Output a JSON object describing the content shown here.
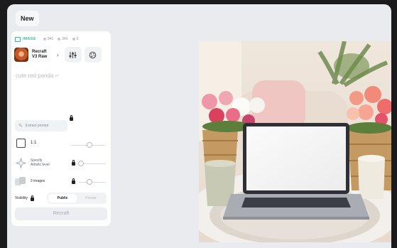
{
  "tab": {
    "label": "New"
  },
  "panel": {
    "meta": {
      "type_label": "IMAGE",
      "count_a": "341",
      "count_b": "341",
      "count_c": "0"
    },
    "model": {
      "name_line1": "Recraft",
      "name_line2": "V3 Raw",
      "chevron": "›"
    },
    "prompt": {
      "text": "cute red panda",
      "return_glyph": "↵"
    },
    "extract_label": "Extract prompt",
    "aspect_label": "1:1",
    "artistic_label_line1": "Specify",
    "artistic_label_line2": "Artistic level",
    "images_label": "2 images",
    "visibility": {
      "label": "Visibility",
      "options": [
        "Public",
        "Private"
      ],
      "selected": "Public"
    },
    "recraft_button": "Recraft"
  },
  "canvas": {
    "image_icon_names": [
      "laptop",
      "flower-baskets",
      "cups",
      "armchair"
    ]
  },
  "colors": {
    "accent": "#35b5a5",
    "panel_bg": "#ffffff",
    "canvas_bg": "#e9ebee",
    "frame_bg": "#1b1b1d"
  }
}
